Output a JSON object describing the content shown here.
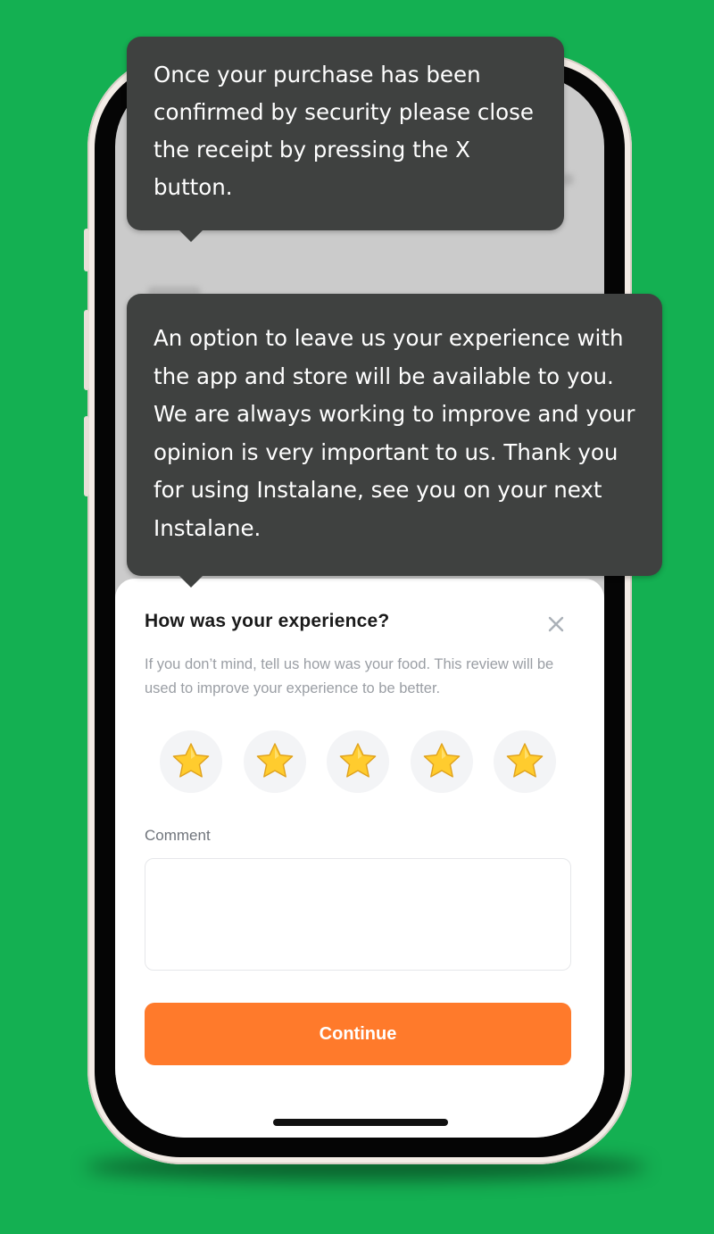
{
  "tooltips": [
    {
      "text": "Once your purchase has been confirmed by security please close the receipt by pressing the X button."
    },
    {
      "text": "An option to leave us your experience with the app and store will be available to you. We are always working to improve and your opinion is very important to us. Thank you for using Instalane, see you on your next Instalane."
    }
  ],
  "review_sheet": {
    "title": "How was your experience?",
    "description": "If you don’t mind, tell us how was your food. This review will be used to improve your experience to be better.",
    "rating": {
      "icon": "star-icon",
      "count": 5,
      "star_color": "#ffcc2e"
    },
    "comment_label": "Comment",
    "comment_value": "",
    "continue_label": "Continue",
    "close_icon": "close-icon"
  },
  "colors": {
    "background": "#14b052",
    "tooltip": "#3f4140",
    "accent": "#ff7a2b"
  }
}
